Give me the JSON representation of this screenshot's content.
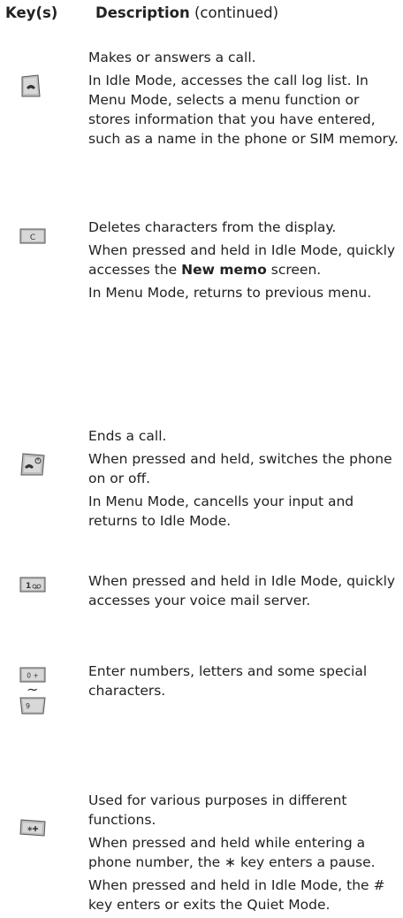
{
  "header": {
    "key_col": "Key(s)",
    "desc_col": "Description",
    "desc_suffix": "(continued)"
  },
  "rows": [
    {
      "icon": "send-key-icon",
      "paras": [
        "Makes or answers a call.",
        "In Idle Mode, accesses the call log list. In Menu Mode, selects a menu function or stores information that you have entered, such as a name in the phone or SIM memory."
      ]
    },
    {
      "icon": "clear-key-icon",
      "icon_label": "C",
      "paras": [
        "Deletes characters from the display.",
        {
          "pre": "When pressed and held in Idle Mode, quickly accesses the ",
          "bold": "New memo",
          "post": " screen."
        },
        "In Menu Mode, returns to previous menu."
      ]
    },
    {
      "icon": "end-power-key-icon",
      "paras": [
        "Ends a call.",
        "When pressed and held, switches the phone on or off.",
        "In Menu Mode, cancells your input and returns to Idle Mode."
      ]
    },
    {
      "icon": "voicemail-key-icon",
      "icon_label": "1",
      "paras": [
        "When pressed and held in Idle Mode, quickly accesses your voice mail server."
      ]
    },
    {
      "icon": "number-keys-icon",
      "icon_label_top": "0 +",
      "icon_label_bottom": "9",
      "range_glyph": "~",
      "paras": [
        "Enter numbers, letters and some special characters."
      ]
    },
    {
      "icon": "star-hash-keys-icon",
      "paras": [
        "Used for various purposes in different functions.",
        "When pressed and held while entering a phone number, the ∗ key enters a pause.",
        "When pressed and held in Idle Mode, the # key enters or exits the Quiet Mode."
      ]
    }
  ]
}
